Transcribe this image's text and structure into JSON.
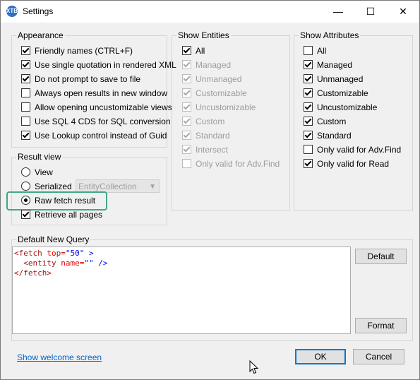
{
  "window": {
    "title": "Settings",
    "app_icon": "XTB",
    "minimize": "—",
    "maximize": "☐",
    "close": "✕"
  },
  "appearance": {
    "legend": "Appearance",
    "items": [
      {
        "label": "Friendly names (CTRL+F)",
        "checked": true
      },
      {
        "label": "Use single quotation in rendered XML",
        "checked": true
      },
      {
        "label": "Do not prompt to save to file",
        "checked": true
      },
      {
        "label": "Always open results in new window",
        "checked": false
      },
      {
        "label": "Allow opening uncustomizable views",
        "checked": false
      },
      {
        "label": "Use SQL 4 CDS for SQL conversion",
        "checked": false
      },
      {
        "label": "Use Lookup control instead of Guid",
        "checked": true
      }
    ]
  },
  "show_entities": {
    "legend": "Show Entities",
    "items": [
      {
        "label": "All",
        "checked": true,
        "disabled": false
      },
      {
        "label": "Managed",
        "checked": true,
        "disabled": true
      },
      {
        "label": "Unmanaged",
        "checked": true,
        "disabled": true
      },
      {
        "label": "Customizable",
        "checked": true,
        "disabled": true
      },
      {
        "label": "Uncustomizable",
        "checked": true,
        "disabled": true
      },
      {
        "label": "Custom",
        "checked": true,
        "disabled": true
      },
      {
        "label": "Standard",
        "checked": true,
        "disabled": true
      },
      {
        "label": "Intersect",
        "checked": true,
        "disabled": true
      },
      {
        "label": "Only valid for Adv.Find",
        "checked": false,
        "disabled": true
      }
    ]
  },
  "show_attributes": {
    "legend": "Show Attributes",
    "items": [
      {
        "label": "All",
        "checked": false
      },
      {
        "label": "Managed",
        "checked": true
      },
      {
        "label": "Unmanaged",
        "checked": true
      },
      {
        "label": "Customizable",
        "checked": true
      },
      {
        "label": "Uncustomizable",
        "checked": true
      },
      {
        "label": "Custom",
        "checked": true
      },
      {
        "label": "Standard",
        "checked": true
      },
      {
        "label": "Only valid for Adv.Find",
        "checked": false
      },
      {
        "label": "Only valid for Read",
        "checked": true
      }
    ]
  },
  "result_view": {
    "legend": "Result view",
    "view_label": "View",
    "serialized_label": "Serialized",
    "serialized_value": "EntityCollection",
    "raw_label": "Raw fetch result",
    "selected": "raw",
    "retrieve_label": "Retrieve all pages",
    "retrieve_checked": true
  },
  "default_query": {
    "legend": "Default New Query",
    "line1_tag": "<fetch",
    "line1_attr": " top=",
    "line1_val": "\"50\"",
    "line1_end": " >",
    "line2_tag": "  <entity",
    "line2_attr": " name=",
    "line2_val": "\"\"",
    "line2_end": " />",
    "line3_tag": "</fetch>",
    "default_button": "Default",
    "format_button": "Format"
  },
  "footer": {
    "welcome_link": "Show welcome screen",
    "ok": "OK",
    "cancel": "Cancel"
  }
}
